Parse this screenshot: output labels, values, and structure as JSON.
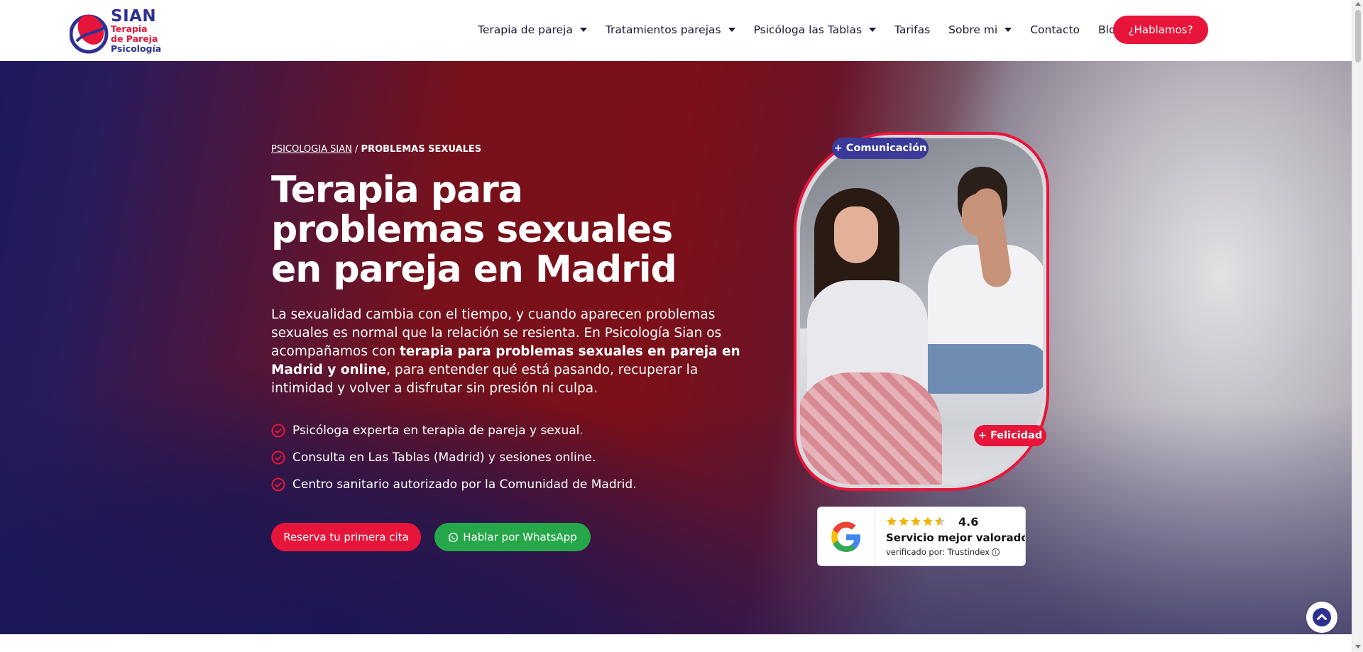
{
  "header": {
    "logo": {
      "title": "SIAN",
      "line1": "Terapia",
      "line2": "de Pareja",
      "line3": "Psicología"
    },
    "nav": [
      {
        "label": "Terapia de pareja",
        "has_dropdown": true
      },
      {
        "label": "Tratamientos parejas",
        "has_dropdown": true
      },
      {
        "label": "Psicóloga las Tablas",
        "has_dropdown": true
      },
      {
        "label": "Tarifas",
        "has_dropdown": false
      },
      {
        "label": "Sobre mi",
        "has_dropdown": true
      },
      {
        "label": "Contacto",
        "has_dropdown": false
      },
      {
        "label": "Blog",
        "has_dropdown": false
      }
    ],
    "cta_label": "¿Hablamos?"
  },
  "hero": {
    "breadcrumb": {
      "home": "PSICOLOGIA SIAN",
      "separator": " / ",
      "current": "PROBLEMAS SEXUALES"
    },
    "title": "Terapia para problemas sexuales en pareja en Madrid",
    "intro": {
      "before": "La sexualidad cambia con el tiempo, y cuando aparecen problemas sexuales es normal que la relación se resienta. En Psicología Sian os acompañamos con ",
      "bold": "terapia para problemas sexuales en pareja en Madrid y online",
      "after": ", para entender qué está pasando, recuperar la intimidad y volver a disfrutar sin presión ni culpa."
    },
    "checklist": [
      "Psicóloga experta en terapia de pareja y sexual.",
      "Consulta en Las Tablas (Madrid) y sesiones online.",
      "Centro sanitario autorizado por la Comunidad de Madrid."
    ],
    "primary_button": "Reserva tu primera cita",
    "whatsapp_button": "Hablar por WhatsApp",
    "tags": {
      "top": "+ Comunicación",
      "bottom": "+ Felicidad"
    }
  },
  "review": {
    "rating": "4.6",
    "rating_value": 4.6,
    "stars_max": 5,
    "title": "Servicio mejor valorado",
    "verified": "verificado por: Trustindex"
  },
  "colors": {
    "accent_red": "#e8153a",
    "brand_navy": "#2e3192",
    "whatsapp_green": "#25a74a",
    "star_gold": "#f6b100"
  },
  "icons": {
    "nav_dropdown": "caret-down-icon",
    "check": "check-circle-icon",
    "whatsapp": "whatsapp-icon",
    "google": "google-g-icon",
    "star": "star-icon",
    "info": "info-icon",
    "to_top": "chevron-up-icon"
  }
}
